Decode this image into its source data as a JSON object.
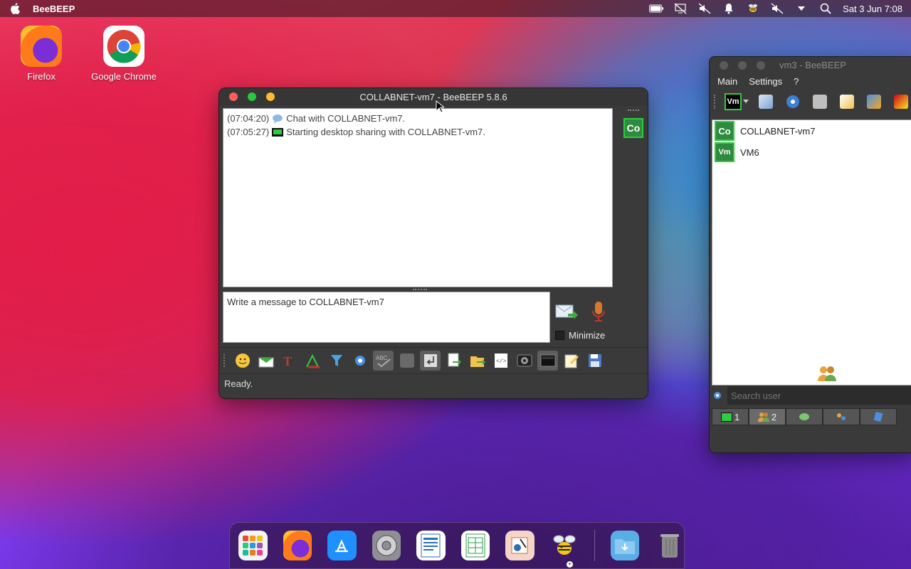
{
  "menubar": {
    "app_name": "BeeBEEP",
    "datetime": "Sat 3 Jun 7:08"
  },
  "desktop": {
    "icons": [
      {
        "label": "Firefox"
      },
      {
        "label": "Google Chrome"
      }
    ]
  },
  "chat_window": {
    "title": "COLLABNET-vm7 - BeeBEEP 5.8.6",
    "messages": [
      {
        "time": "(07:04:20)",
        "text": "Chat with COLLABNET-vm7."
      },
      {
        "time": "(07:05:27)",
        "text": "Starting desktop sharing with COLLABNET-vm7."
      }
    ],
    "avatar_initials": "Co",
    "message_placeholder": "Write a message to COLLABNET-vm7",
    "minimize_label": "Minimize",
    "status_text": "Ready."
  },
  "main_window": {
    "title": "vm3 - BeeBEEP",
    "menu": [
      "Main",
      "Settings",
      "?"
    ],
    "users": [
      {
        "initials": "Co",
        "name": "COLLABNET-vm7"
      },
      {
        "initials": "Vm",
        "name": "VM6"
      }
    ],
    "search_placeholder": "Search user",
    "tabs": [
      {
        "count": "1"
      },
      {
        "count": "2"
      }
    ],
    "self_badge": "Vm"
  },
  "colors": {
    "avatar_border": "#2ecc40",
    "avatar_bg": "#2d8a3e",
    "window_bg": "#3a3a3a"
  }
}
